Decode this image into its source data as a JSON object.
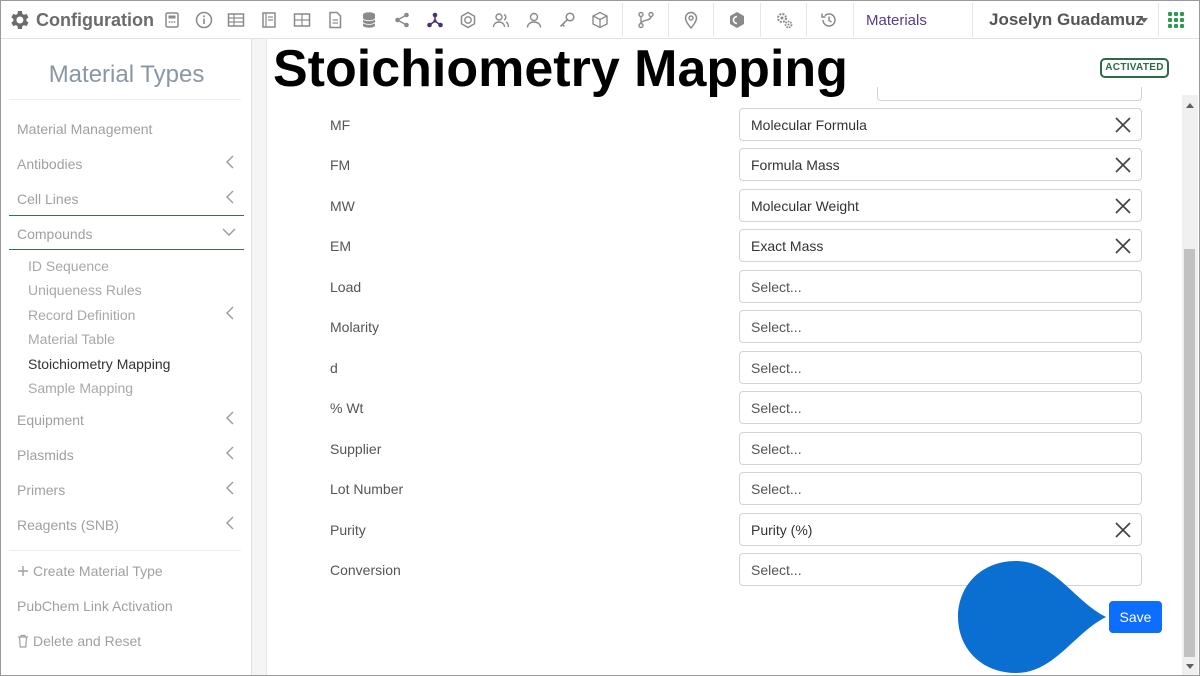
{
  "app": {
    "title": "Configuration",
    "materials_link": "Materials",
    "user_name": "Joselyn Guadamuz",
    "toolbar_icons": [
      "calculator-icon",
      "info-icon",
      "table-icon",
      "notebook-icon",
      "grid-table-icon",
      "document-icon",
      "database-icon",
      "share-icon",
      "network-icon",
      "hexagon-icon",
      "users-icon",
      "user-icon",
      "key-icon",
      "cube-icon",
      "workflow-icon",
      "location-pin-icon",
      "plugin-icon",
      "settings-gears-icon",
      "history-icon"
    ],
    "brand_color": "#6b6b6b",
    "accent_color": "#5b3a8a"
  },
  "sidebar": {
    "title": "Material Types",
    "items": [
      {
        "label": "Material Management",
        "chevron": false
      },
      {
        "label": "Antibodies",
        "chevron": true
      },
      {
        "label": "Cell Lines",
        "chevron": true
      },
      {
        "label": "Compounds",
        "chevron": true,
        "expanded": true
      },
      {
        "label": "Equipment",
        "chevron": true
      },
      {
        "label": "Plasmids",
        "chevron": true
      },
      {
        "label": "Primers",
        "chevron": true
      },
      {
        "label": "Reagents (SNB)",
        "chevron": true
      }
    ],
    "compound_subitems": [
      {
        "label": "ID Sequence"
      },
      {
        "label": "Uniqueness Rules"
      },
      {
        "label": "Record Definition",
        "chevron": true
      },
      {
        "label": "Material Table"
      },
      {
        "label": "Stoichiometry Mapping",
        "active": true
      },
      {
        "label": "Sample Mapping"
      }
    ],
    "actions": [
      {
        "label": "Create Material Type",
        "icon": "plus-icon"
      },
      {
        "label": "PubChem Link Activation"
      },
      {
        "label": "Delete and Reset",
        "icon": "trash-icon"
      }
    ]
  },
  "main": {
    "page_title": "Stoichiometry Mapping",
    "status_badge": "ACTIVATED",
    "status_color": "#2c6b45",
    "fields": [
      {
        "label": "MF",
        "value": "Molecular Formula",
        "clearable": true
      },
      {
        "label": "FM",
        "value": "Formula Mass",
        "clearable": true
      },
      {
        "label": "MW",
        "value": "Molecular Weight",
        "clearable": true
      },
      {
        "label": "EM",
        "value": "Exact Mass",
        "clearable": true
      },
      {
        "label": "Load",
        "value": "Select...",
        "clearable": false
      },
      {
        "label": "Molarity",
        "value": "Select...",
        "clearable": false
      },
      {
        "label": "d",
        "value": "Select...",
        "clearable": false
      },
      {
        "label": "% Wt",
        "value": "Select...",
        "clearable": false
      },
      {
        "label": "Supplier",
        "value": "Select...",
        "clearable": false
      },
      {
        "label": "Lot Number",
        "value": "Select...",
        "clearable": false
      },
      {
        "label": "Purity",
        "value": "Purity (%)",
        "clearable": true
      },
      {
        "label": "Conversion",
        "value": "Select...",
        "clearable": false
      }
    ],
    "save_label": "Save",
    "save_color": "#0d6efd"
  }
}
